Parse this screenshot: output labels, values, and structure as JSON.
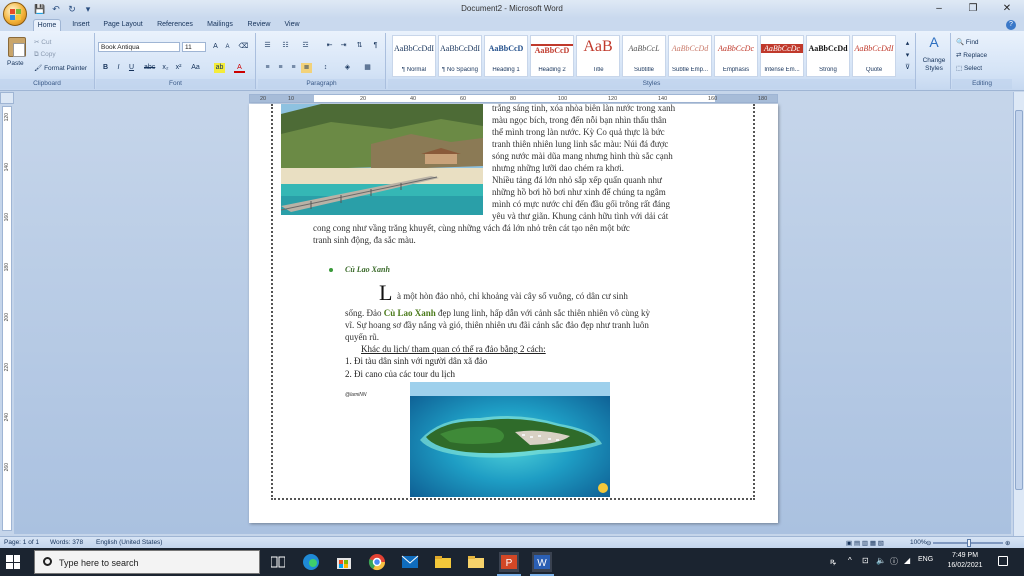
{
  "window": {
    "title": "Document2 - Microsoft Word",
    "minimize": "–",
    "restore": "❐",
    "close": "✕"
  },
  "qat": {
    "save": "💾",
    "undo": "↶",
    "redo": "↻",
    "more": "▾"
  },
  "tabs": [
    "Home",
    "Insert",
    "Page Layout",
    "References",
    "Mailings",
    "Review",
    "View"
  ],
  "ribbon": {
    "clipboard": {
      "label": "Clipboard",
      "paste": "Paste",
      "cut": "Cut",
      "copy": "Copy",
      "format_painter": "Format Painter"
    },
    "font": {
      "label": "Font",
      "name": "Book Antiqua",
      "size": "11"
    },
    "paragraph": {
      "label": "Paragraph"
    },
    "styles": {
      "label": "Styles",
      "items": [
        {
          "sample": "AaBbCcDdI",
          "name": "¶ Normal"
        },
        {
          "sample": "AaBbCcDdI",
          "name": "¶ No Spacing"
        },
        {
          "sample": "AaBbCcD",
          "name": "Heading 1"
        },
        {
          "sample": "AaBbCcD",
          "name": "Heading 2"
        },
        {
          "sample": "AaB",
          "name": "Title"
        },
        {
          "sample": "AaBbCcL",
          "name": "Subtitle"
        },
        {
          "sample": "AaBbCcDd",
          "name": "Subtle Emp..."
        },
        {
          "sample": "AaBbCcDc",
          "name": "Emphasis"
        },
        {
          "sample": "AaBbCcDc",
          "name": "Intense Em..."
        },
        {
          "sample": "AaBbCcDd",
          "name": "Strong"
        },
        {
          "sample": "AaBbCcDdI",
          "name": "Quote"
        }
      ],
      "change_styles": "Change Styles"
    },
    "editing": {
      "label": "Editing",
      "find": "Find",
      "replace": "Replace",
      "select": "Select"
    }
  },
  "ruler": {
    "ticks": [
      "20",
      "10",
      "20",
      "40",
      "60",
      "80",
      "100",
      "120",
      "140",
      "160",
      "180"
    ]
  },
  "vruler": {
    "ticks": [
      "120",
      "140",
      "160",
      "180",
      "200",
      "220",
      "240",
      "260"
    ]
  },
  "document": {
    "para1_lines": [
      "trắng sáng tinh, xóa nhòa biên làn nước trong xanh",
      "màu ngọc bích, trong đến nỗi bạn nhìn thấu thân",
      "thể mình trong làn nước. Kỳ Co quả thực là bức",
      "tranh thiên nhiên lung linh sắc màu: Núi đá được",
      "sóng nước mài dũa mang nhưng hình thù sắc cạnh",
      "nhưng những lưỡi dao chém ra khơi.",
      "Nhiều tảng đá lớn nhỏ sắp xếp quấn quanh như",
      "những hồ bơi hồ bơi như xinh để chúng ta ngâm",
      "mình có mực nước chỉ đến đầu gối trông rất đáng",
      "yêu và thư giãn.  Khung cảnh hữu tình với dải cát"
    ],
    "para1_full_lines": [
      "cong cong như vầng trăng khuyết, cùng những vách đá lớn nhỏ trên cát tạo nên một bức",
      "tranh sinh động, đa sắc màu."
    ],
    "bullet_title": "Cù Lao Xanh",
    "dropcap": "L",
    "para2_first": "à một hòn đảo nhỏ, chỉ khoảng vài cây số vuông, có dân cư sinh",
    "para2_line2_a": "sống. Đảo ",
    "para2_line2_hl": "Cù Lao Xanh",
    "para2_line2_b": " đẹp lung linh, hấp dẫn với cảnh sắc thiên nhiên vô cùng kỳ",
    "para2_lines": [
      "vĩ. Sự hoang sơ đầy nắng và gió, thiên nhiên ưu đãi cảnh sắc đảo đẹp như tranh luôn",
      "quyến rũ."
    ],
    "sub_heading": "Khác du lịch/ tham quan có thể ra đảo bằng 2 cách:",
    "list": [
      "1.  Đi tàu dân sinh với người dân xã đảo",
      "2.  Đi cano của các tour du lịch"
    ],
    "credit": "@lamiNN"
  },
  "status": {
    "page": "Page: 1 of 1",
    "words": "Words: 378",
    "language": "English (United States)",
    "zoom": "100%"
  },
  "taskbar": {
    "search_placeholder": "Type here to search",
    "time": "7:49 PM",
    "date": "16/02/2021",
    "lang": "ENG"
  }
}
